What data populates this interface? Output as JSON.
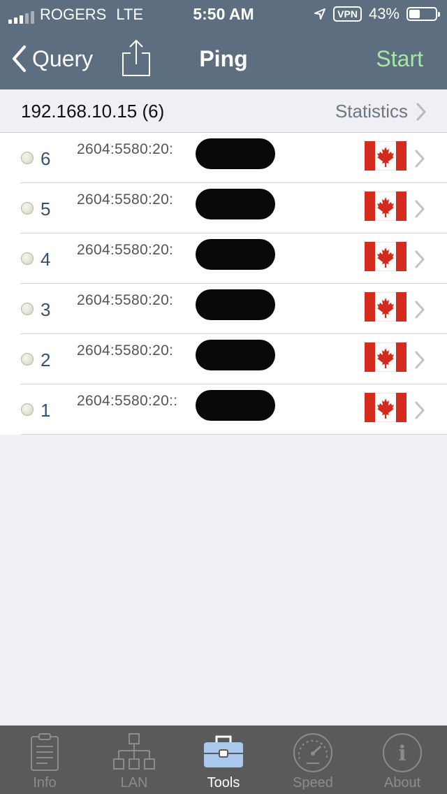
{
  "status_bar": {
    "carrier": "ROGERS",
    "network": "LTE",
    "time": "5:50 AM",
    "vpn": "VPN",
    "battery_text": "43%",
    "battery_level": 0.43
  },
  "nav": {
    "back_label": "Query",
    "title": "Ping",
    "start_label": "Start"
  },
  "section": {
    "host": "192.168.10.15 (6)",
    "statistics_label": "Statistics"
  },
  "rows": [
    {
      "num": "6",
      "address": "2604:5580:20:"
    },
    {
      "num": "5",
      "address": "2604:5580:20:"
    },
    {
      "num": "4",
      "address": "2604:5580:20:"
    },
    {
      "num": "3",
      "address": "2604:5580:20:"
    },
    {
      "num": "2",
      "address": "2604:5580:20:"
    },
    {
      "num": "1",
      "address": "2604:5580:20::"
    }
  ],
  "tabs": [
    {
      "label": "Info",
      "icon": "clipboard-icon"
    },
    {
      "label": "LAN",
      "icon": "network-tree-icon"
    },
    {
      "label": "Tools",
      "icon": "toolbox-icon",
      "active": true
    },
    {
      "label": "Speed",
      "icon": "speedometer-icon"
    },
    {
      "label": "About",
      "icon": "info-circle-icon"
    }
  ],
  "colors": {
    "bar": "#5d6e80",
    "start": "#a6e8a0",
    "tabbar": "#5a5a5c",
    "number": "#35507a",
    "flag_red": "#d52b1e"
  }
}
